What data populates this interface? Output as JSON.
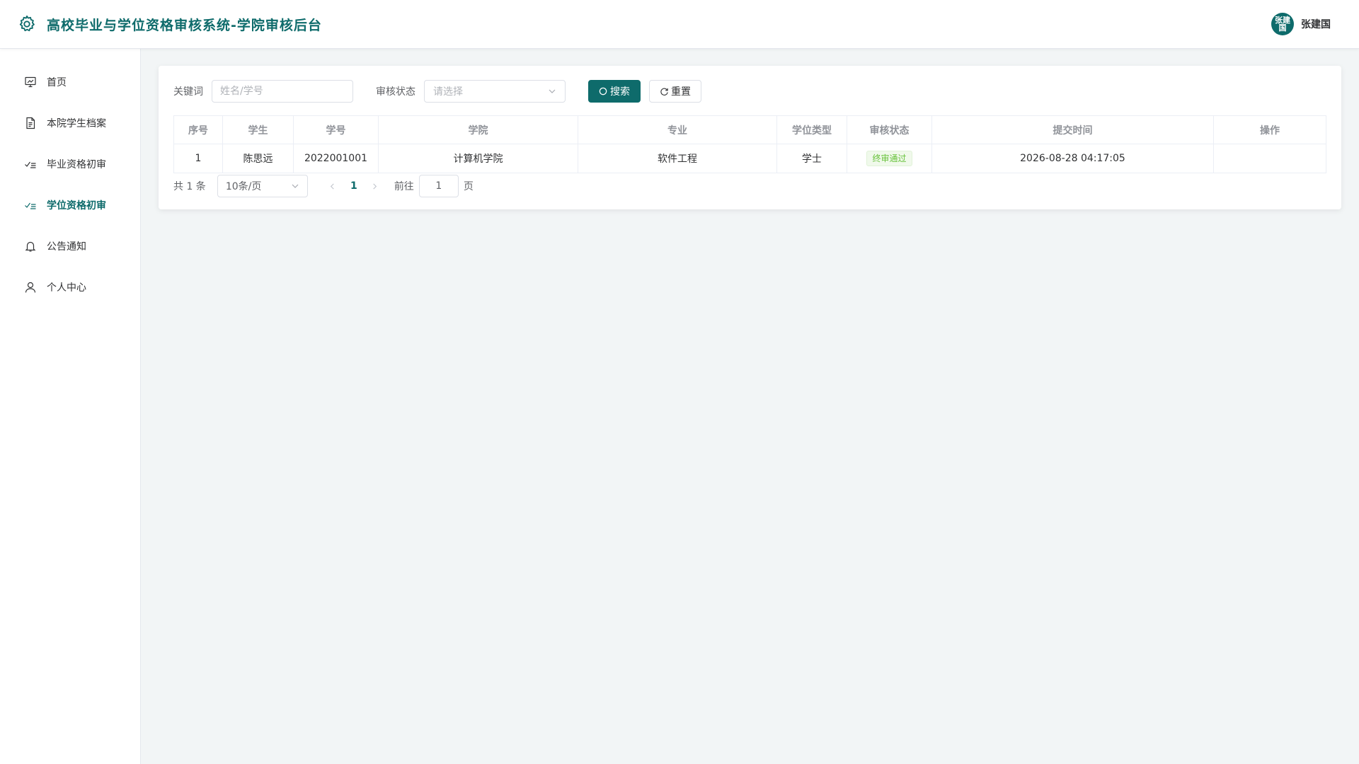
{
  "header": {
    "title": "高校毕业与学位资格审核系统-学院审核后台",
    "user_avatar_text": "张建国",
    "user_name": "张建国"
  },
  "sidebar": {
    "items": [
      {
        "label": "首页",
        "icon": "presentation-board-icon",
        "active": false
      },
      {
        "label": "本院学生档案",
        "icon": "document-icon",
        "active": false
      },
      {
        "label": "毕业资格初审",
        "icon": "checklist-icon",
        "active": false
      },
      {
        "label": "学位资格初审",
        "icon": "checklist-icon",
        "active": true
      },
      {
        "label": "公告通知",
        "icon": "bell-icon",
        "active": false
      },
      {
        "label": "个人中心",
        "icon": "user-icon",
        "active": false
      }
    ]
  },
  "filters": {
    "keyword_label": "关键词",
    "keyword_placeholder": "姓名/学号",
    "status_label": "审核状态",
    "status_placeholder": "请选择",
    "search_label": "搜索",
    "reset_label": "重置"
  },
  "table": {
    "columns": [
      "序号",
      "学生",
      "学号",
      "学院",
      "专业",
      "学位类型",
      "审核状态",
      "提交时间",
      "操作"
    ],
    "rows": [
      {
        "index": "1",
        "student": "陈思远",
        "student_id": "2022001001",
        "college": "计算机学院",
        "major": "软件工程",
        "degree_type": "学士",
        "status": "终审通过",
        "submitted_at": "2026-08-28 04:17:05",
        "action": ""
      }
    ]
  },
  "pagination": {
    "total_text": "共 1 条",
    "page_size": "10条/页",
    "current_page": "1",
    "goto_prefix": "前往",
    "goto_value": "1",
    "goto_suffix": "页"
  },
  "colors": {
    "brand": "#0e6b6b",
    "success_tag": "#67c23a"
  }
}
